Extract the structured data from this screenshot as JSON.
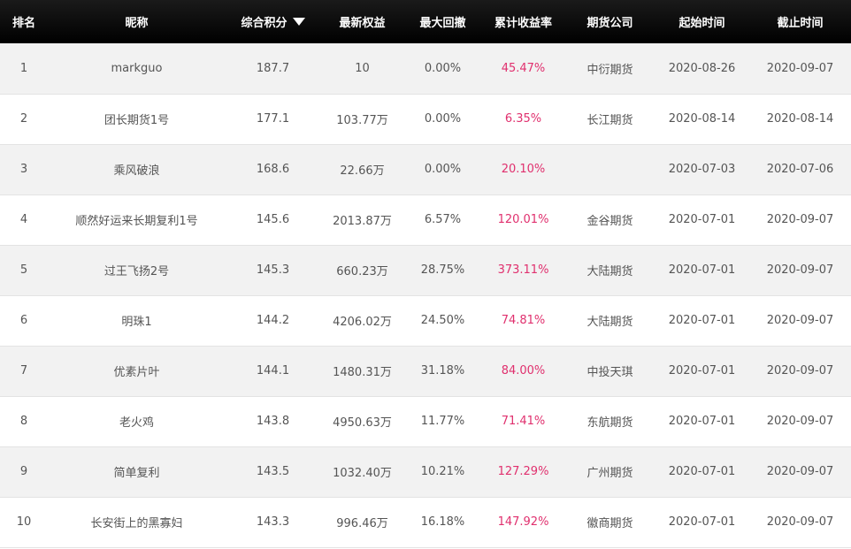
{
  "header": {
    "rank": "排名",
    "nickname": "昵称",
    "score": "综合积分",
    "equity": "最新权益",
    "drawdown": "最大回撤",
    "return": "累计收益率",
    "company": "期货公司",
    "start": "起始时间",
    "end": "截止时间"
  },
  "accent_color": "#e0306e",
  "rows": [
    {
      "rank": "1",
      "nickname": "markguo",
      "score": "187.7",
      "equity": "10",
      "drawdown": "0.00%",
      "return": "45.47%",
      "company": "中衍期货",
      "start": "2020-08-26",
      "end": "2020-09-07"
    },
    {
      "rank": "2",
      "nickname": "团长期货1号",
      "score": "177.1",
      "equity": "103.77万",
      "drawdown": "0.00%",
      "return": "6.35%",
      "company": "长江期货",
      "start": "2020-08-14",
      "end": "2020-08-14"
    },
    {
      "rank": "3",
      "nickname": "乘风破浪",
      "score": "168.6",
      "equity": "22.66万",
      "drawdown": "0.00%",
      "return": "20.10%",
      "company": "",
      "start": "2020-07-03",
      "end": "2020-07-06"
    },
    {
      "rank": "4",
      "nickname": "顺然好运来长期复利1号",
      "score": "145.6",
      "equity": "2013.87万",
      "drawdown": "6.57%",
      "return": "120.01%",
      "company": "金谷期货",
      "start": "2020-07-01",
      "end": "2020-09-07"
    },
    {
      "rank": "5",
      "nickname": "过王飞扬2号",
      "score": "145.3",
      "equity": "660.23万",
      "drawdown": "28.75%",
      "return": "373.11%",
      "company": "大陆期货",
      "start": "2020-07-01",
      "end": "2020-09-07"
    },
    {
      "rank": "6",
      "nickname": "明珠1",
      "score": "144.2",
      "equity": "4206.02万",
      "drawdown": "24.50%",
      "return": "74.81%",
      "company": "大陆期货",
      "start": "2020-07-01",
      "end": "2020-09-07"
    },
    {
      "rank": "7",
      "nickname": "优素片叶",
      "score": "144.1",
      "equity": "1480.31万",
      "drawdown": "31.18%",
      "return": "84.00%",
      "company": "中投天琪",
      "start": "2020-07-01",
      "end": "2020-09-07"
    },
    {
      "rank": "8",
      "nickname": "老火鸡",
      "score": "143.8",
      "equity": "4950.63万",
      "drawdown": "11.77%",
      "return": "71.41%",
      "company": "东航期货",
      "start": "2020-07-01",
      "end": "2020-09-07"
    },
    {
      "rank": "9",
      "nickname": "简单复利",
      "score": "143.5",
      "equity": "1032.40万",
      "drawdown": "10.21%",
      "return": "127.29%",
      "company": "广州期货",
      "start": "2020-07-01",
      "end": "2020-09-07"
    },
    {
      "rank": "10",
      "nickname": "长安街上的黑寡妇",
      "score": "143.3",
      "equity": "996.46万",
      "drawdown": "16.18%",
      "return": "147.92%",
      "company": "徽商期货",
      "start": "2020-07-01",
      "end": "2020-09-07"
    }
  ]
}
